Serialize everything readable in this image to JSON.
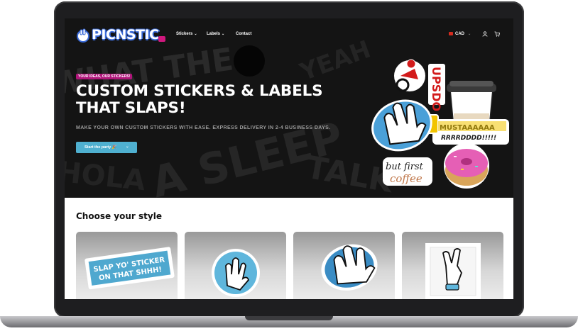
{
  "nav": {
    "logo_text": "PICNSTIC",
    "items": [
      {
        "label": "Stickers",
        "has_dropdown": true
      },
      {
        "label": "Labels",
        "has_dropdown": true
      },
      {
        "label": "Contact",
        "has_dropdown": false
      }
    ],
    "currency": "CAD"
  },
  "hero": {
    "badge": "YOUR IDEAS, OUR STICKERS!",
    "title_line1": "CUSTOM STICKERS & LABELS",
    "title_line2": "THAT SLAPS!",
    "subtitle": "MAKE YOUR OWN CUSTOM STICKERS WITH EASE. EXPRESS DELIVERY IN 2-4 BUSINESS DAYS.",
    "cta_label": "Start the party 🎉",
    "sticker_texts": {
      "mustard": "MUSTAAAAAA RRRRDDDD!!!!!",
      "coffee": "but first coffee",
      "upside": "UPSDO"
    },
    "slide_count": 3,
    "active_slide": 1
  },
  "styles": {
    "title": "Choose your style",
    "cards": [
      {
        "sticker_text_1": "SLAP YO' STICKER",
        "sticker_text_2": "ON THAT SHHH!"
      },
      {},
      {},
      {}
    ]
  },
  "colors": {
    "accent_blue": "#4fb0d0",
    "badge_magenta": "#b0157a",
    "hero_bg": "#141414"
  }
}
